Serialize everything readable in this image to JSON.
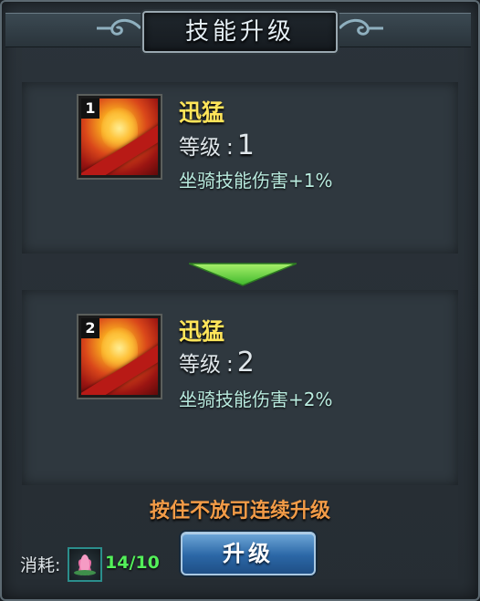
{
  "dialog": {
    "title": "技能升级"
  },
  "current_skill": {
    "badge": "1",
    "name": "迅猛",
    "level_label": "等级",
    "level_colon": ":",
    "level_value": "1",
    "effect": "坐骑技能伤害+1%"
  },
  "next_skill": {
    "badge": "2",
    "name": "迅猛",
    "level_label": "等级",
    "level_colon": ":",
    "level_value": "2",
    "effect": "坐骑技能伤害+2%"
  },
  "hint": "按住不放可连续升级",
  "cost": {
    "label": "消耗:",
    "item_icon": "lotus-flower-icon",
    "count": "14/10"
  },
  "upgrade_button_label": "升级",
  "colors": {
    "skill_name": "#ffe55a",
    "effect_text": "#b9ebdf",
    "hint_text": "#f29b47",
    "cost_count": "#53f05a",
    "arrow": "#7ed941"
  }
}
